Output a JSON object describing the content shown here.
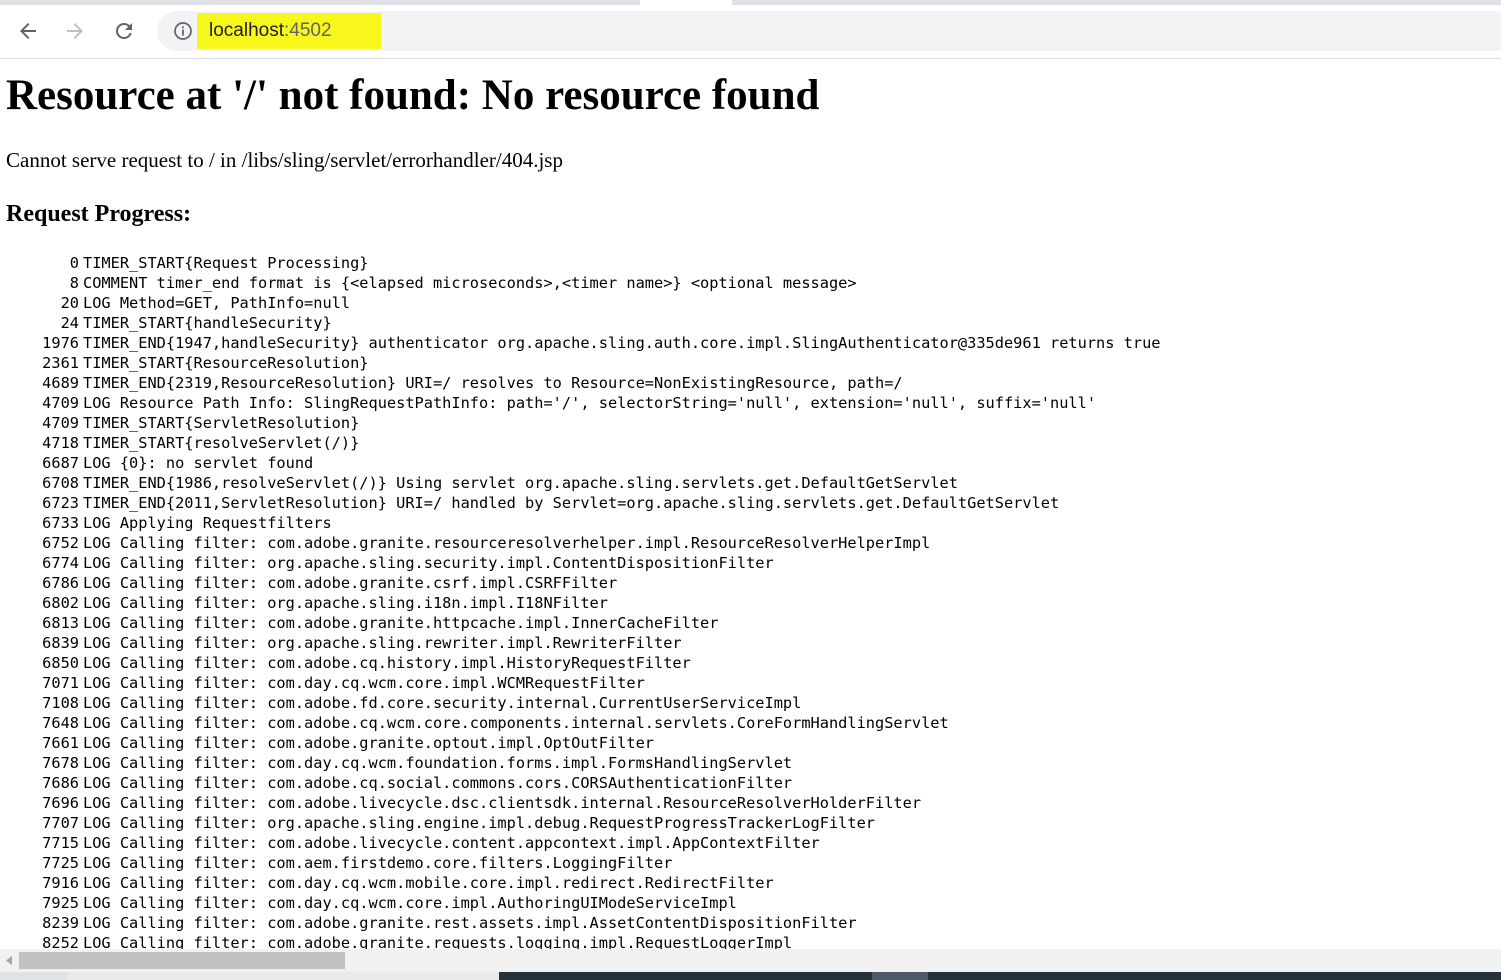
{
  "browser": {
    "url_host": "localhost",
    "url_port": ":4502",
    "highlight_color": "#f7f71b",
    "icons": [
      "back-icon",
      "forward-icon",
      "reload-icon",
      "info-icon"
    ]
  },
  "page": {
    "title": "Resource at '/' not found: No resource found",
    "subtitle": "Cannot serve request to / in /libs/sling/servlet/errorhandler/404.jsp",
    "progress_heading": "Request Progress:",
    "progress_lines": [
      {
        "time": "0",
        "message": "TIMER_START{Request Processing}"
      },
      {
        "time": "8",
        "message": "COMMENT timer_end format is {<elapsed microseconds>,<timer name>} <optional message>"
      },
      {
        "time": "20",
        "message": "LOG Method=GET, PathInfo=null"
      },
      {
        "time": "24",
        "message": "TIMER_START{handleSecurity}"
      },
      {
        "time": "1976",
        "message": "TIMER_END{1947,handleSecurity} authenticator org.apache.sling.auth.core.impl.SlingAuthenticator@335de961 returns true"
      },
      {
        "time": "2361",
        "message": "TIMER_START{ResourceResolution}"
      },
      {
        "time": "4689",
        "message": "TIMER_END{2319,ResourceResolution} URI=/ resolves to Resource=NonExistingResource, path=/"
      },
      {
        "time": "4709",
        "message": "LOG Resource Path Info: SlingRequestPathInfo: path='/', selectorString='null', extension='null', suffix='null'"
      },
      {
        "time": "4709",
        "message": "TIMER_START{ServletResolution}"
      },
      {
        "time": "4718",
        "message": "TIMER_START{resolveServlet(/)}"
      },
      {
        "time": "6687",
        "message": "LOG {0}: no servlet found"
      },
      {
        "time": "6708",
        "message": "TIMER_END{1986,resolveServlet(/)} Using servlet org.apache.sling.servlets.get.DefaultGetServlet"
      },
      {
        "time": "6723",
        "message": "TIMER_END{2011,ServletResolution} URI=/ handled by Servlet=org.apache.sling.servlets.get.DefaultGetServlet"
      },
      {
        "time": "6733",
        "message": "LOG Applying Requestfilters"
      },
      {
        "time": "6752",
        "message": "LOG Calling filter: com.adobe.granite.resourceresolverhelper.impl.ResourceResolverHelperImpl"
      },
      {
        "time": "6774",
        "message": "LOG Calling filter: org.apache.sling.security.impl.ContentDispositionFilter"
      },
      {
        "time": "6786",
        "message": "LOG Calling filter: com.adobe.granite.csrf.impl.CSRFFilter"
      },
      {
        "time": "6802",
        "message": "LOG Calling filter: org.apache.sling.i18n.impl.I18NFilter"
      },
      {
        "time": "6813",
        "message": "LOG Calling filter: com.adobe.granite.httpcache.impl.InnerCacheFilter"
      },
      {
        "time": "6839",
        "message": "LOG Calling filter: org.apache.sling.rewriter.impl.RewriterFilter"
      },
      {
        "time": "6850",
        "message": "LOG Calling filter: com.adobe.cq.history.impl.HistoryRequestFilter"
      },
      {
        "time": "7071",
        "message": "LOG Calling filter: com.day.cq.wcm.core.impl.WCMRequestFilter"
      },
      {
        "time": "7108",
        "message": "LOG Calling filter: com.adobe.fd.core.security.internal.CurrentUserServiceImpl"
      },
      {
        "time": "7648",
        "message": "LOG Calling filter: com.adobe.cq.wcm.core.components.internal.servlets.CoreFormHandlingServlet"
      },
      {
        "time": "7661",
        "message": "LOG Calling filter: com.adobe.granite.optout.impl.OptOutFilter"
      },
      {
        "time": "7678",
        "message": "LOG Calling filter: com.day.cq.wcm.foundation.forms.impl.FormsHandlingServlet"
      },
      {
        "time": "7686",
        "message": "LOG Calling filter: com.adobe.cq.social.commons.cors.CORSAuthenticationFilter"
      },
      {
        "time": "7696",
        "message": "LOG Calling filter: com.adobe.livecycle.dsc.clientsdk.internal.ResourceResolverHolderFilter"
      },
      {
        "time": "7707",
        "message": "LOG Calling filter: org.apache.sling.engine.impl.debug.RequestProgressTrackerLogFilter"
      },
      {
        "time": "7715",
        "message": "LOG Calling filter: com.adobe.livecycle.content.appcontext.impl.AppContextFilter"
      },
      {
        "time": "7725",
        "message": "LOG Calling filter: com.aem.firstdemo.core.filters.LoggingFilter"
      },
      {
        "time": "7916",
        "message": "LOG Calling filter: com.day.cq.wcm.mobile.core.impl.redirect.RedirectFilter"
      },
      {
        "time": "7925",
        "message": "LOG Calling filter: com.day.cq.wcm.core.impl.AuthoringUIModeServiceImpl"
      },
      {
        "time": "8239",
        "message": "LOG Calling filter: com.adobe.granite.rest.assets.impl.AssetContentDispositionFilter"
      },
      {
        "time": "8252",
        "message": "LOG Calling filter: com.adobe.granite.requests.logging.impl.RequestLoggerImpl"
      }
    ]
  }
}
